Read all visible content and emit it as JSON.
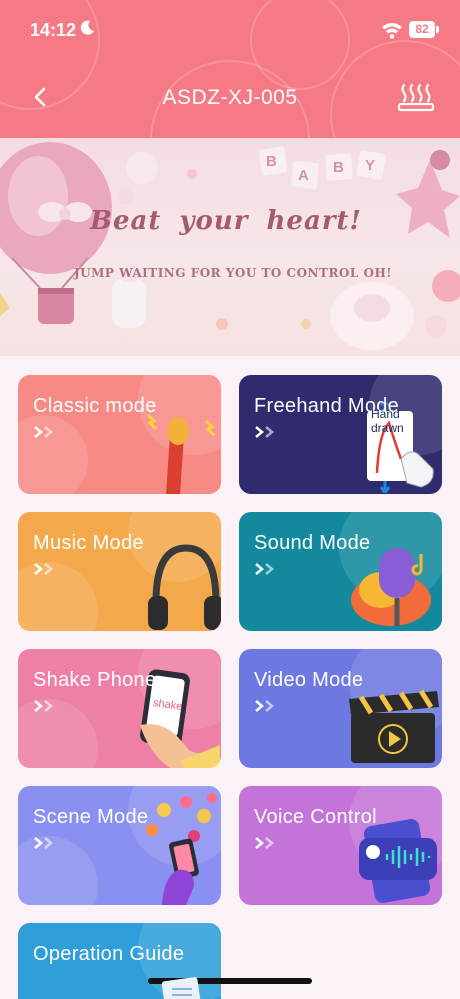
{
  "status_bar": {
    "time": "14:12",
    "battery": "82"
  },
  "header": {
    "title": "ASDZ-XJ-005"
  },
  "banner": {
    "headline": "Beat your heart!",
    "subline": "JUMP WAITING FOR YOU TO CONTROL OH!",
    "blocks": [
      "B",
      "A",
      "B",
      "Y"
    ]
  },
  "modes": [
    {
      "label": "Classic mode",
      "color": "#f88a86"
    },
    {
      "label": "Freehand Mode",
      "color": "#2f2b6e",
      "illustration_text": "Hand drawn"
    },
    {
      "label": "Music Mode",
      "color": "#f4a84c"
    },
    {
      "label": "Sound Mode",
      "color": "#12899c"
    },
    {
      "label": "Shake Phone",
      "color": "#ee7fa6",
      "illustration_text": "shake"
    },
    {
      "label": "Video Mode",
      "color": "#6d78e0"
    },
    {
      "label": "Scene Mode",
      "color": "#8a90f0"
    },
    {
      "label": "Voice Control",
      "color": "#c473d8"
    },
    {
      "label": "Operation Guide",
      "color": "#2e9fd8"
    }
  ]
}
